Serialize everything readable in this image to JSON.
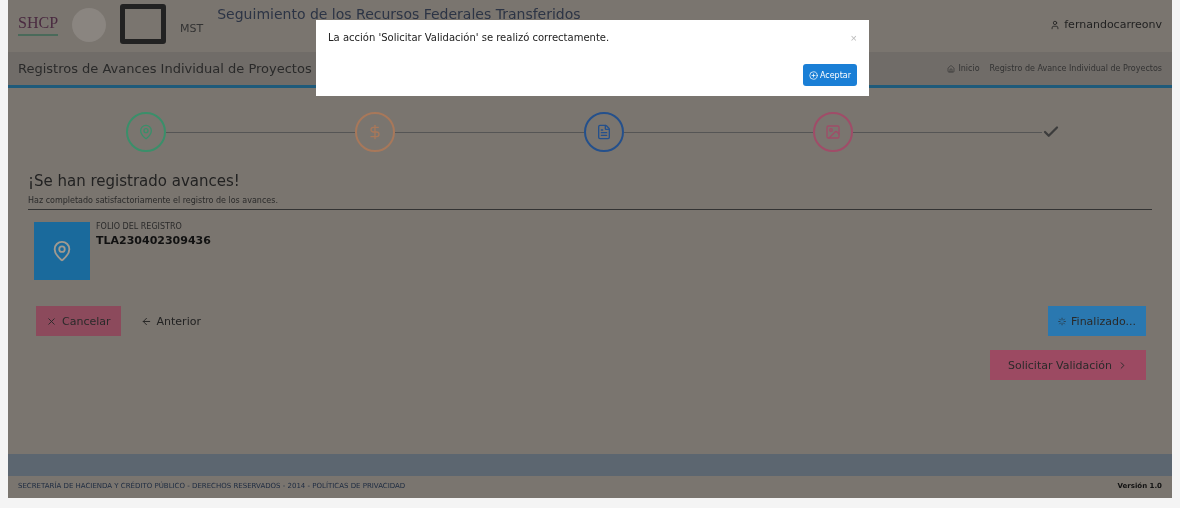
{
  "header": {
    "logo_text": "SHCP",
    "app_label": "MST",
    "title": "Seguimiento de los Recursos Federales Transferidos",
    "user": "fernandocarreonv"
  },
  "page": {
    "title": "Registros de Avances Individual de Proyectos",
    "breadcrumb": [
      "Inicio",
      "Registro de Avance Individual de Proyectos"
    ]
  },
  "steps": [
    {
      "color": "#3a8f6a"
    },
    {
      "color": "#a8785a"
    },
    {
      "color": "#24508c"
    },
    {
      "color": "#a04c68"
    },
    {
      "color": "#3c3c3c"
    }
  ],
  "result": {
    "heading": "¡Se han registrado avances!",
    "message": "Haz completado satisfactoriamente el registro de los avances.",
    "folio_label": "FOLIO DEL REGISTRO",
    "folio": "TLA230402309436"
  },
  "actions": {
    "cancel": "Cancelar",
    "previous": "Anterior",
    "finish": "Finalizado...",
    "validate": "Solicitar Validación"
  },
  "footer": {
    "text": "SECRETARÍA DE HACIENDA Y CRÉDITO PÚBLICO - DERECHOS RESERVADOS - 2014 - POLÍTICAS DE PRIVACIDAD",
    "version": "Versión 1.0"
  },
  "modal": {
    "message": "La acción 'Solicitar Validación' se realizó correctamente.",
    "close": "×",
    "button": "Aceptar"
  }
}
